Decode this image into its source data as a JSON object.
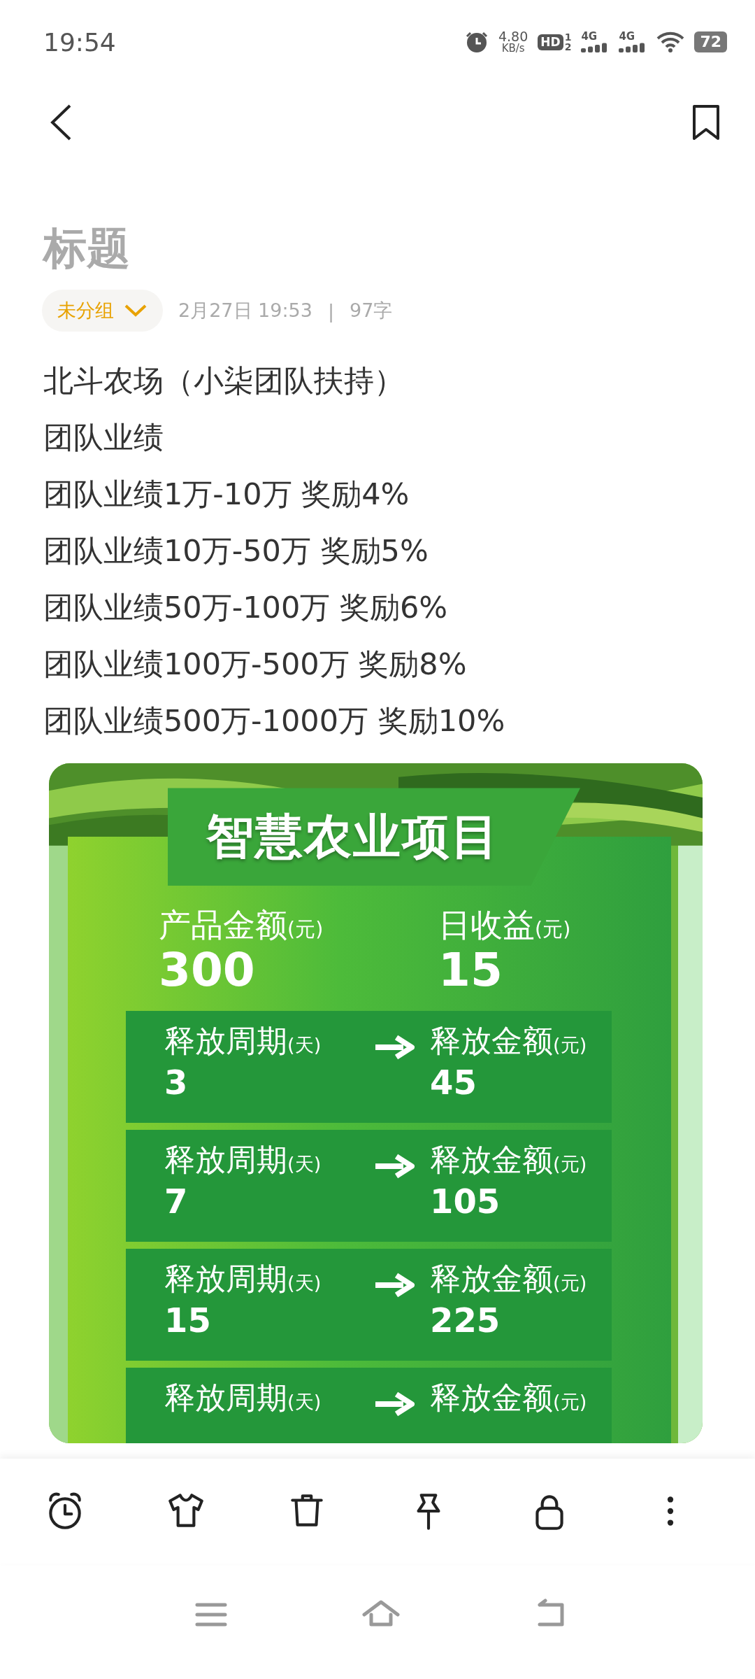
{
  "status_bar": {
    "time": "19:54",
    "speed": "4.80",
    "speed_unit": "KB/s",
    "hd": "HD",
    "sim_slots": [
      "1",
      "2"
    ],
    "signals": [
      {
        "label": "4G"
      },
      {
        "label": "4G"
      }
    ],
    "battery": "72"
  },
  "note": {
    "title": "标题",
    "group": "未分组",
    "date": "2月27日 19:53",
    "separator": "|",
    "count": "97字",
    "lines": [
      "北斗农场（小柒团队扶持）",
      "团队业绩",
      "团队业绩1万-10万 奖励4%",
      "团队业绩10万-50万 奖励5%",
      "团队业绩50万-100万 奖励6%",
      "团队业绩100万-500万 奖励8%",
      "团队业绩500万-1000万 奖励10%"
    ]
  },
  "poster": {
    "title": "智慧农业项目",
    "stats": [
      {
        "label": "产品金额",
        "unit": "(元)",
        "value": "300"
      },
      {
        "label": "日收益",
        "unit": "(元)",
        "value": "15"
      }
    ],
    "rows": [
      {
        "left_label": "释放周期",
        "left_unit": "(天)",
        "left_value": "3",
        "right_label": "释放金额",
        "right_unit": "(元)",
        "right_value": "45"
      },
      {
        "left_label": "释放周期",
        "left_unit": "(天)",
        "left_value": "7",
        "right_label": "释放金额",
        "right_unit": "(元)",
        "right_value": "105"
      },
      {
        "left_label": "释放周期",
        "left_unit": "(天)",
        "left_value": "15",
        "right_label": "释放金额",
        "right_unit": "(元)",
        "right_value": "225"
      },
      {
        "left_label": "释放周期",
        "left_unit": "(天)",
        "right_label": "释放金额",
        "right_unit": "(元)"
      }
    ]
  },
  "toolbar": [
    {
      "kind": "alarm"
    },
    {
      "kind": "shirt"
    },
    {
      "kind": "trash"
    },
    {
      "kind": "pin"
    },
    {
      "kind": "lock"
    },
    {
      "kind": "more"
    }
  ],
  "nav_bar": [
    {
      "kind": "menu"
    },
    {
      "kind": "home"
    },
    {
      "kind": "back"
    }
  ]
}
